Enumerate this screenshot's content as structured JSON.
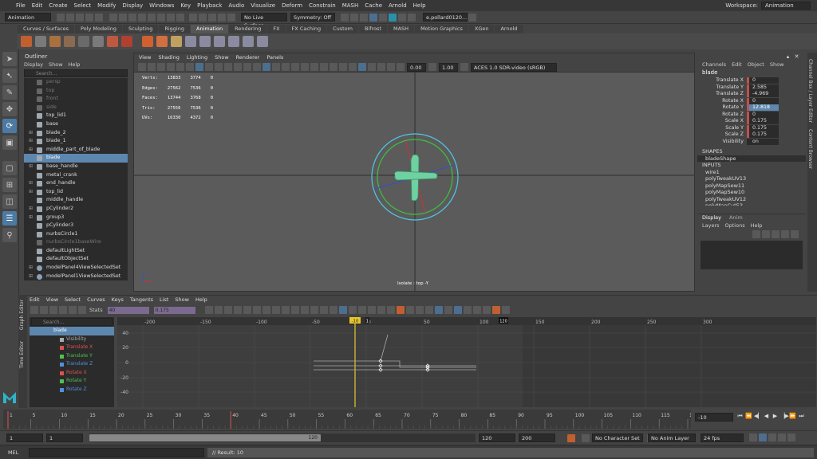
{
  "menubar": {
    "items": [
      "File",
      "Edit",
      "Create",
      "Select",
      "Modify",
      "Display",
      "Windows",
      "Key",
      "Playback",
      "Audio",
      "Visualize",
      "Deform",
      "Constrain",
      "MASH",
      "Cache",
      "Arnold",
      "Help"
    ],
    "workspace_label": "Workspace:",
    "workspace_value": "Animation"
  },
  "statusline": {
    "mode": "Animation",
    "live_surface": "No Live Surface",
    "symmetry": "Symmetry: Off",
    "user": "e.pollard0120..."
  },
  "shelf": {
    "tabs": [
      "Curves / Surfaces",
      "Poly Modeling",
      "Sculpting",
      "Rigging",
      "Animation",
      "Rendering",
      "FX",
      "FX Caching",
      "Custom",
      "Bifrost",
      "MASH",
      "Motion Graphics",
      "XGen",
      "Arnold"
    ],
    "active_tab": "Animation"
  },
  "outliner": {
    "title": "Outliner",
    "menu": [
      "Display",
      "Show",
      "Help"
    ],
    "search_placeholder": "Search...",
    "items": [
      {
        "label": "persp",
        "dim": true,
        "exp": ""
      },
      {
        "label": "top",
        "dim": true,
        "exp": ""
      },
      {
        "label": "front",
        "dim": true,
        "exp": ""
      },
      {
        "label": "side",
        "dim": true,
        "exp": ""
      },
      {
        "label": "top_lid1",
        "dim": false,
        "exp": ""
      },
      {
        "label": "base",
        "dim": false,
        "exp": ""
      },
      {
        "label": "blade_2",
        "dim": false,
        "exp": "+"
      },
      {
        "label": "blade_1",
        "dim": false,
        "exp": "+"
      },
      {
        "label": "middle_part_of_blade",
        "dim": false,
        "exp": "+"
      },
      {
        "label": "blade",
        "dim": false,
        "exp": "",
        "sel": true
      },
      {
        "label": "base_handle",
        "dim": false,
        "exp": "+"
      },
      {
        "label": "metal_crank",
        "dim": false,
        "exp": ""
      },
      {
        "label": "end_handle",
        "dim": false,
        "exp": "+"
      },
      {
        "label": "top_lid",
        "dim": false,
        "exp": "+"
      },
      {
        "label": "middle_handle",
        "dim": false,
        "exp": ""
      },
      {
        "label": "pCylinder2",
        "dim": false,
        "exp": "+"
      },
      {
        "label": "group3",
        "dim": false,
        "exp": "+"
      },
      {
        "label": "pCylinder3",
        "dim": false,
        "exp": ""
      },
      {
        "label": "nurbsCircle1",
        "dim": false,
        "exp": ""
      },
      {
        "label": "nurbsCircle1baseWire",
        "dim": true,
        "exp": ""
      },
      {
        "label": "defaultLightSet",
        "dim": false,
        "exp": ""
      },
      {
        "label": "defaultObjectSet",
        "dim": false,
        "exp": ""
      },
      {
        "label": "modelPanel4ViewSelectedSet",
        "dim": false,
        "exp": "+",
        "set": true
      },
      {
        "label": "modelPanel1ViewSelectedSet",
        "dim": false,
        "exp": "+",
        "set": true
      }
    ]
  },
  "viewport": {
    "menu": [
      "View",
      "Shading",
      "Lighting",
      "Show",
      "Renderer",
      "Panels"
    ],
    "exposure": "0.00",
    "gamma": "1.00",
    "colorspace": "ACES 1.0 SDR-video (sRGB)",
    "hud": [
      [
        "Verts:",
        "13833",
        "3774",
        "0"
      ],
      [
        "Edges:",
        "27562",
        "7536",
        "0"
      ],
      [
        "Faces:",
        "13744",
        "3768",
        "0"
      ],
      [
        "Tris:",
        "27556",
        "7536",
        "0"
      ],
      [
        "UVs:",
        "16330",
        "4372",
        "0"
      ]
    ],
    "isolate_label": "Isolate : top -Y"
  },
  "channelbox": {
    "menu": [
      "Channels",
      "Edit",
      "Object",
      "Show"
    ],
    "object": "blade",
    "attributes": [
      {
        "name": "Translate X",
        "value": "0"
      },
      {
        "name": "Translate Y",
        "value": "2.585"
      },
      {
        "name": "Translate Z",
        "value": "-4.969"
      },
      {
        "name": "Rotate X",
        "value": "0"
      },
      {
        "name": "Rotate Y",
        "value": "12.818",
        "hl": true
      },
      {
        "name": "Rotate Z",
        "value": "0"
      },
      {
        "name": "Scale X",
        "value": "0.175"
      },
      {
        "name": "Scale Y",
        "value": "0.175"
      },
      {
        "name": "Scale Z",
        "value": "0.175"
      },
      {
        "name": "Visibility",
        "value": "on",
        "plain": true
      }
    ],
    "shapes_header": "SHAPES",
    "shape": "bladeShape",
    "inputs_header": "INPUTS",
    "inputs": [
      "wire1",
      "polyTweakUV13",
      "polyMapSew11",
      "polyMapSew10",
      "polyTweakUV12",
      "polyMapCut53",
      "polyMapCut52",
      "polyMapCut51"
    ],
    "layer_tabs": [
      "Display",
      "Anim"
    ],
    "layer_menu": [
      "Layers",
      "Options",
      "Help"
    ],
    "side_tabs": [
      "Channel Box / Layer Editor",
      "Content Browser"
    ]
  },
  "graph_editor": {
    "side_label": "Graph Editor",
    "side_label2": "Time Editor",
    "menu": [
      "Edit",
      "View",
      "Select",
      "Curves",
      "Keys",
      "Tangents",
      "List",
      "Show",
      "Help"
    ],
    "stats_label": "Stats",
    "stat1": "40",
    "stat2": "0.175",
    "search_placeholder": "Search...",
    "channels": [
      {
        "label": "blade",
        "sel": true,
        "color": "#ffffff"
      },
      {
        "label": "Visibility",
        "color": "#aaaaaa"
      },
      {
        "label": "Translate X",
        "color": "#e05050"
      },
      {
        "label": "Translate Y",
        "color": "#50c050"
      },
      {
        "label": "Translate Z",
        "color": "#5090e0"
      },
      {
        "label": "Rotate X",
        "color": "#e05050"
      },
      {
        "label": "Rotate Y",
        "color": "#50c050"
      },
      {
        "label": "Rotate Z",
        "color": "#5090e0"
      }
    ],
    "ruler": [
      "-200",
      "-150",
      "-100",
      "-50",
      "0",
      "50",
      "100",
      "150",
      "200",
      "250",
      "300"
    ],
    "yticks": [
      "40",
      "20",
      "0",
      "-20",
      "-40"
    ],
    "current_frame": "-10",
    "end_marker": "120",
    "start_marker": "1"
  },
  "timeslider": {
    "ticks": [
      "1",
      "5",
      "10",
      "15",
      "20",
      "25",
      "30",
      "35",
      "40",
      "45",
      "50",
      "55",
      "60",
      "65",
      "70",
      "75",
      "80",
      "85",
      "90",
      "95",
      "100",
      "105",
      "110",
      "115",
      "120"
    ],
    "current": "-10"
  },
  "range": {
    "start": "1",
    "start2": "1",
    "slider_end": "120",
    "end": "120",
    "end2": "200",
    "character_set": "No Character Set",
    "anim_layer": "No Anim Layer",
    "fps": "24 fps"
  },
  "cmdline": {
    "lang": "MEL",
    "result": "// Result: 10"
  },
  "colors": {
    "selection": "#5d87ae",
    "timeline_marker": "#f0d020",
    "key_red": "#c0504d"
  }
}
